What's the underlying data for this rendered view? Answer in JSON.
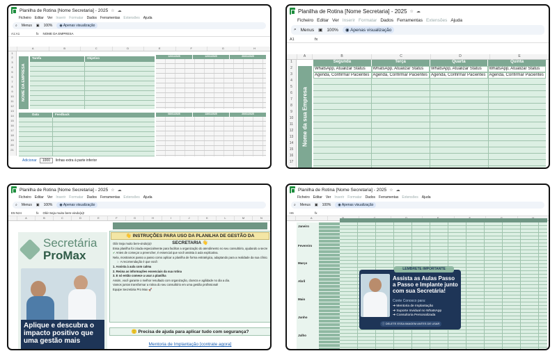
{
  "screen1": {
    "doc_title": "Planilha de Rotina [Nome Secretaria] - 2025",
    "menu": [
      "Ficheiro",
      "Editar",
      "Ver",
      "Inserir",
      "Formatar",
      "Dados",
      "Ferramentas",
      "Extensões",
      "Ajuda"
    ],
    "toolbar": {
      "menus": "Menus",
      "zoom": "100%",
      "view_only": "Apenas visualização"
    },
    "cell_ref": "A1:A1",
    "formula": "NOME DA EMPRESA",
    "vertical_label": "NOME DA EMPRESA",
    "headers_top": {
      "tarefa": "Tarefa",
      "objetivo": "Objetivo"
    },
    "date_cols": [
      "12/01/2025",
      "12/01/2025",
      "20/01/2025"
    ],
    "headers_mid": {
      "data": "Data",
      "feedback": "Feedback"
    },
    "date_cols2": [
      "06/01/2025",
      "13/01/2025",
      "20/01/2025"
    ],
    "add_rows": {
      "button": "Adicionar",
      "count": "1000",
      "suffix": "linhas extra à parte inferior"
    },
    "row_numbers": [
      "1",
      "2",
      "3",
      "4",
      "5",
      "6",
      "7",
      "8",
      "9",
      "10",
      "11",
      "12",
      "13",
      "14",
      "15",
      "16",
      "17",
      "18",
      "19",
      "20",
      "21"
    ]
  },
  "screen2": {
    "doc_title": "Planilha de Rotina [Nome Secretaria] - 2025",
    "menu": [
      "Ficheiro",
      "Editar",
      "Ver",
      "Inserir",
      "Formatar",
      "Dados",
      "Ferramentas",
      "Extensões",
      "Ajuda"
    ],
    "toolbar": {
      "menus": "Menus",
      "zoom": "100%",
      "view_only": "Apenas visualização"
    },
    "cell_ref": "A1",
    "columns": [
      "A",
      "B",
      "C",
      "D",
      "E"
    ],
    "days": [
      "Segunda",
      "Terça",
      "Quarta",
      "Quinta"
    ],
    "row2": [
      "WhatsApp, Atualizar Status",
      "WhatsApp, Atualizar Status",
      "WhatsApp, Atualizar Status",
      "WhatsApp, Atualizar Status"
    ],
    "row3": [
      "Agenda, Confirmar Pacientes",
      "Agenda, Confirmar Pacientes",
      "Agenda, Confirmar Pacientes",
      "Agenda, Confirmar Pacientes"
    ],
    "vertical_label": "Nome da sua Empresa",
    "row_numbers": [
      "1",
      "2",
      "3",
      "4",
      "5",
      "6",
      "7",
      "8",
      "9",
      "10",
      "11",
      "12",
      "13",
      "14",
      "15",
      "16",
      "17"
    ]
  },
  "screen3": {
    "doc_title": "Planilha de Rotina [Nome Secretaria] - 2025",
    "menu": [
      "Ficheiro",
      "Editar",
      "Ver",
      "Inserir",
      "Formatar",
      "Dados",
      "Ferramentas",
      "Extensões",
      "Ajuda"
    ],
    "toolbar": {
      "menus": "Menus",
      "zoom": "100%",
      "view_only": "Apenas visualização"
    },
    "cell_ref": "E5:N24",
    "formula": "Olá! Seja muito bem-vindo(a)!",
    "brand_line1": "Secretária",
    "brand_line2": "ProMax",
    "instructions_title": "INSTRUÇÕES PARA USO DA PLANILHA DE GESTÃO DA SECRETARIA",
    "greeting": "Olá! Seja muito bem-vindo(a)!",
    "intro": "Essa planilha foi criada especialmente para facilitar a organização do atendimento no seu consultório, ajudando a secretária...",
    "check_line": "Antes de começar a preencher, é essencial que você assista à aula explicativa.",
    "note_line": "Nela, mostramos passo a passo como aplicar a planilha de forma estratégica, adaptando para a realidade da sua clínica.",
    "rec_title": "A recomendação é que você:",
    "step1": "1. Assista à aula com calma",
    "step2": "2. Reúna as informações essenciais da sua rotina",
    "step3": "3. E só então comece a usar a planilha",
    "after": "Assim, você garante o melhor resultado com organização, clareza e agilidade no dia a dia.",
    "together": "Vamos juntos transformar a rotina do seu consultório em uma gestão profissional!",
    "signature": "Equipe Secretária Pro Max",
    "help_title": "Precisa de ajuda para aplicar tudo com segurança?",
    "help_link": "Mentoria de Implantação [contrate agora]",
    "promo_text": "Aplique e descubra o impacto positivo que uma gestão mais"
  },
  "screen4": {
    "doc_title": "Planilha de Rotina [Nome Secretaria] - 2025",
    "menu": [
      "Ficheiro",
      "Editar",
      "Ver",
      "Inserir",
      "Formatar",
      "Dados",
      "Ferramentas",
      "Extensões",
      "Ajuda"
    ],
    "toolbar": {
      "menus": "Menus",
      "zoom": "100%",
      "view_only": "Apenas visualização"
    },
    "cell_ref": "H6",
    "months": [
      "Janeiro",
      "Fevereiro",
      "Março",
      "Abril",
      "Maio",
      "Junho",
      "Julho"
    ],
    "badge": "LEMBRETE IMPORTANTE",
    "headline": "Assista as Aulas Passo a Passo e Implante junto com sua Secretária!",
    "count_on": "Conte Conosco para:",
    "bullets": [
      "Mentoria de Implantação",
      "Suporte Invidual no WhatsApp",
      "Consultoria Personalizada"
    ],
    "delete_note": "DELETE ESSA IMAGEM ANTES DE USAR"
  }
}
